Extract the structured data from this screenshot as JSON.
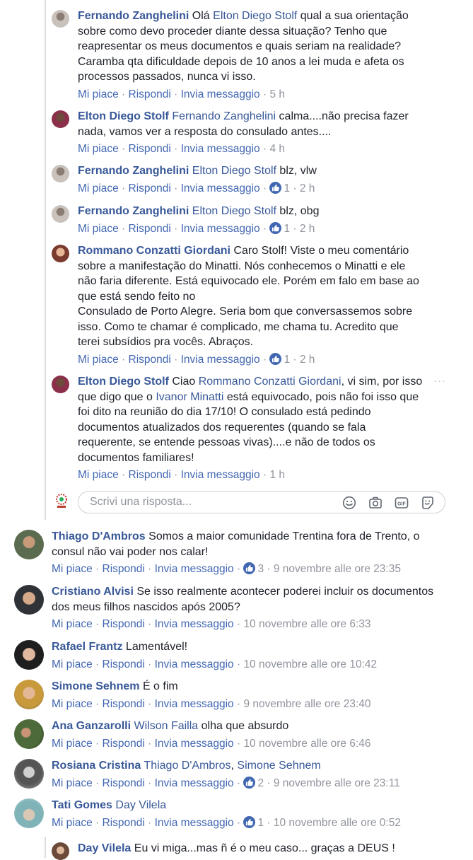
{
  "replies": [
    {
      "name": "Fernando Zanghelini",
      "mentions": [
        "Elton Diego Stolf"
      ],
      "parts": [
        "Olá ",
        "Elton Diego Stolf",
        " qual a sua orientação",
        "sobre como devo proceder diante dessa situação? Tenho que",
        "reapresentar os meus documentos e quais seriam na realidade?",
        "Caramba qta dificuldade depois de 10 anos a lei muda e afeta os",
        "processos passados, nunca vi isso."
      ],
      "like": "Mi piace",
      "reply": "Rispondi",
      "message": "Invia messaggio",
      "time": "5 h"
    },
    {
      "name": "Elton Diego Stolf",
      "parts": [
        "Fernando Zanghelini",
        " calma....não precisa fazer",
        "nada, vamos ver a resposta do consulado antes...."
      ],
      "like": "Mi piace",
      "reply": "Rispondi",
      "message": "Invia messaggio",
      "time": "4 h"
    },
    {
      "name": "Fernando Zanghelini",
      "parts": [
        "Elton Diego Stolf",
        " blz, vlw"
      ],
      "like": "Mi piace",
      "reply": "Rispondi",
      "message": "Invia messaggio",
      "reactions": "1",
      "time": "2 h"
    },
    {
      "name": "Fernando Zanghelini",
      "parts": [
        "Elton Diego Stolf",
        " blz, obg"
      ],
      "like": "Mi piace",
      "reply": "Rispondi",
      "message": "Invia messaggio",
      "reactions": "1",
      "time": "2 h"
    },
    {
      "name": "Rommano Conzatti Giordani",
      "parts": [
        "Caro Stolf! Viste o meu comentário",
        "sobre a manifestação do Minatti. Nós conhecemos o Minatti e ele",
        "não faria diferente. Está equivocado ele. Porém em falo em base ao",
        "que está sendo feito no",
        "Consulado de Porto Alegre. Seria bom que conversassemos sobre",
        "isso. Como te chamar é complicado, me chama tu. Acredito que",
        "terei subsídios pra vocês. Abraços."
      ],
      "like": "Mi piace",
      "reply": "Rispondi",
      "message": "Invia messaggio",
      "reactions": "1",
      "time": "2 h"
    },
    {
      "name": "Elton Diego Stolf",
      "parts": [
        "Ciao ",
        "Rommano Conzatti Giordani",
        ", vi sim, por isso",
        "que digo que o ",
        "Ivanor Minatti",
        " está equivocado, pois não foi isso que",
        "foi dito na reunião do dia 17/10! O consulado está pedindo",
        "documentos atualizados dos requerentes (quando se fala",
        "requerente, se entende pessoas vivas)....e não de todos os",
        "documentos familiares!"
      ],
      "like": "Mi piace",
      "reply": "Rispondi",
      "message": "Invia messaggio",
      "time": "1 h",
      "more": "···"
    }
  ],
  "reply_box": {
    "placeholder": "Scrivi una risposta..."
  },
  "comments": [
    {
      "name": "Thiago D'Ambros",
      "parts": [
        "Somos a maior comunidade Trentina fora de Trento, o",
        "consul não vai poder nos calar!"
      ],
      "like": "Mi piace",
      "reply": "Rispondi",
      "message": "Invia messaggio",
      "reactions": "3",
      "time": "9 novembre alle ore 23:35"
    },
    {
      "name": "Cristiano Alvisi",
      "parts": [
        "Se isso realmente acontecer poderei incluir os documentos",
        "dos meus filhos nascidos após 2005?"
      ],
      "like": "Mi piace",
      "reply": "Rispondi",
      "message": "Invia messaggio",
      "time": "10 novembre alle ore 6:33"
    },
    {
      "name": "Rafael Frantz",
      "parts": [
        "Lamentável!"
      ],
      "like": "Mi piace",
      "reply": "Rispondi",
      "message": "Invia messaggio",
      "time": "10 novembre alle ore 10:42"
    },
    {
      "name": "Simone Sehnem",
      "parts": [
        "É o fim"
      ],
      "like": "Mi piace",
      "reply": "Rispondi",
      "message": "Invia messaggio",
      "time": "9 novembre alle ore 23:40"
    },
    {
      "name": "Ana Ganzarolli",
      "parts": [
        "Wilson Failla",
        " olha que absurdo"
      ],
      "like": "Mi piace",
      "reply": "Rispondi",
      "message": "Invia messaggio",
      "time": "10 novembre alle ore 6:46"
    },
    {
      "name": "Rosiana Cristina",
      "parts": [
        "Thiago D'Ambros",
        ", ",
        "Simone Sehnem"
      ],
      "like": "Mi piace",
      "reply": "Rispondi",
      "message": "Invia messaggio",
      "reactions": "2",
      "time": "9 novembre alle ore 23:11"
    },
    {
      "name": "Tati Gomes",
      "parts": [
        "Day Vilela"
      ],
      "like": "Mi piace",
      "reply": "Rispondi",
      "message": "Invia messaggio",
      "reactions": "1",
      "time": "10 novembre alle ore 0:52"
    }
  ],
  "last_reply": {
    "name": "Day Vilela",
    "text": "Eu vi miga...mas ñ é o meu caso... graças a DEUS !"
  },
  "separator": "·",
  "icons": [
    "emoji-icon",
    "camera-icon",
    "gif-icon",
    "sticker-icon",
    "like-reaction-icon"
  ],
  "colors": {
    "link": "#385898",
    "action": "#4267b2",
    "meta": "#90949c",
    "text": "#1d2129"
  }
}
